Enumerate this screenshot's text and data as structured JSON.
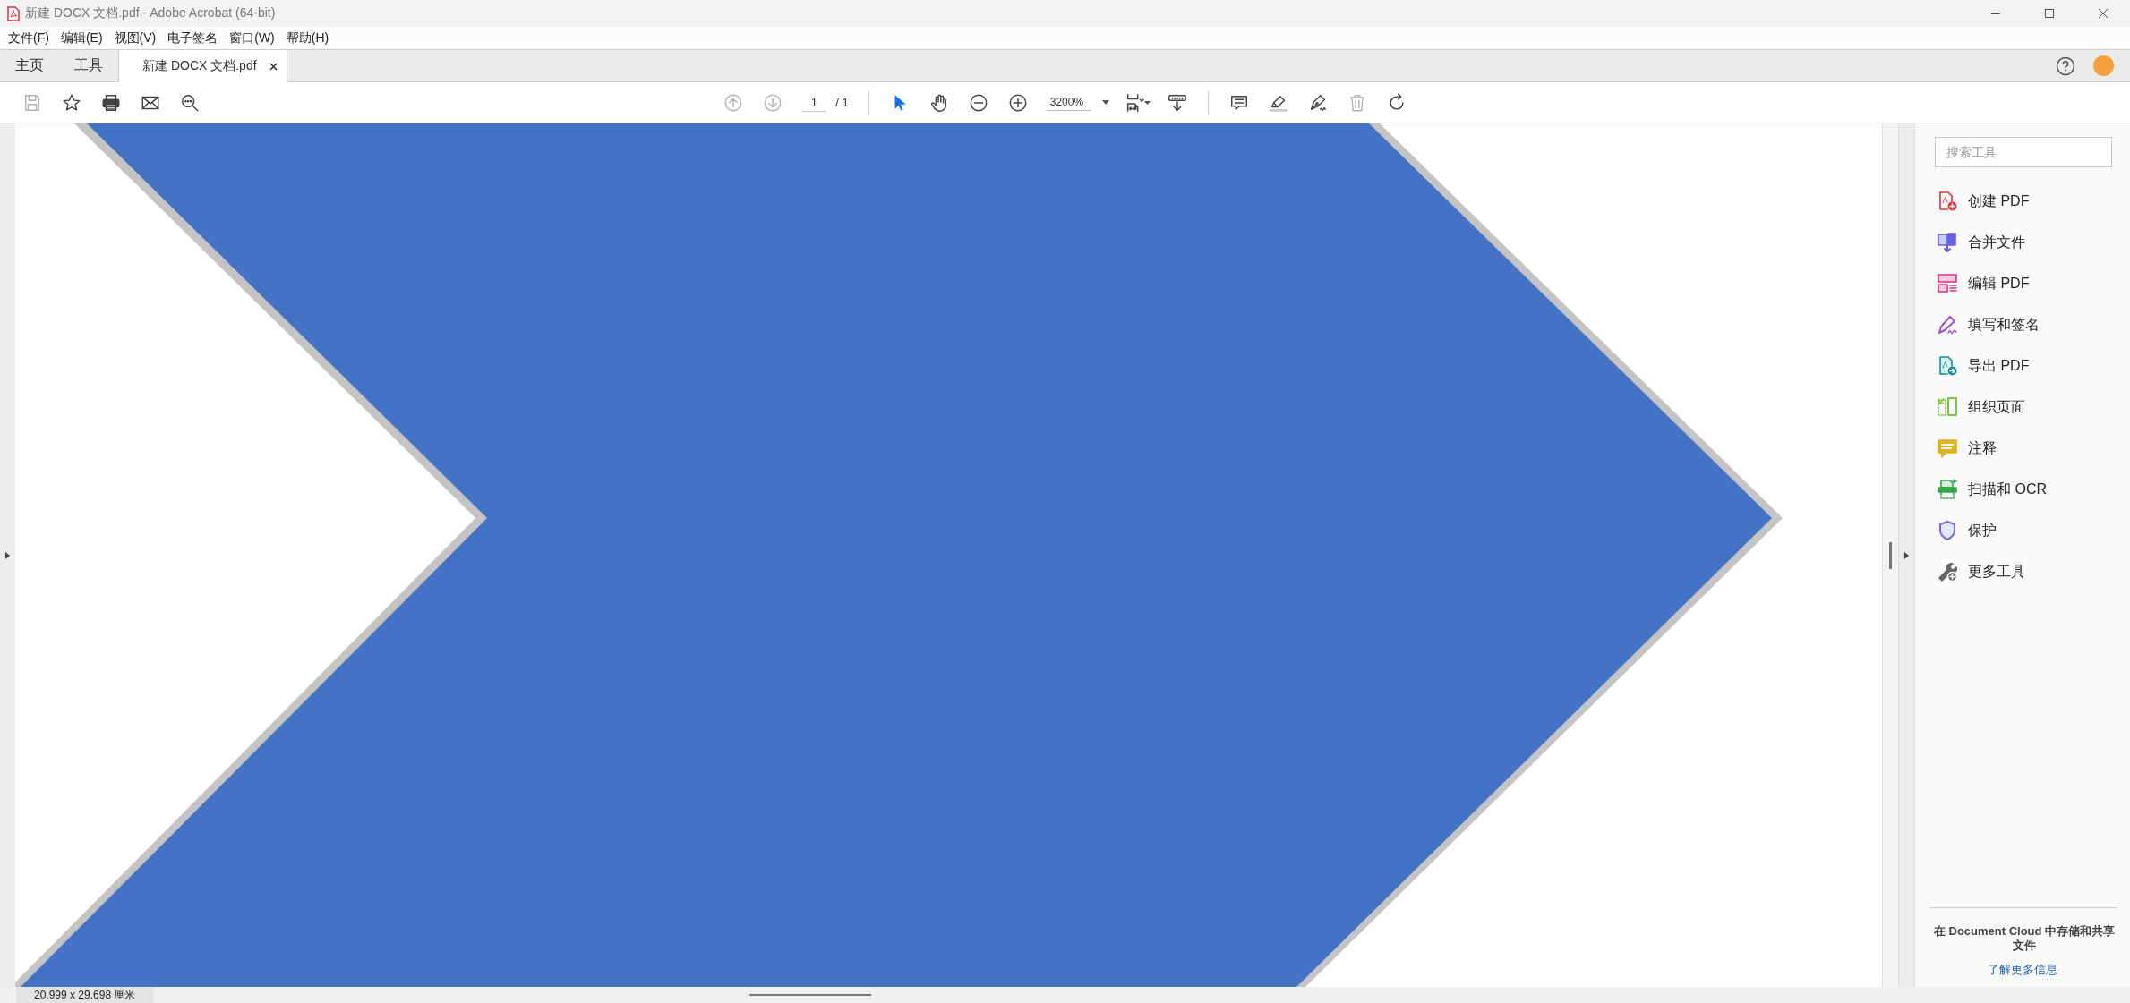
{
  "window": {
    "title": "新建 DOCX 文档.pdf - Adobe Acrobat (64-bit)"
  },
  "menu": [
    "文件(F)",
    "编辑(E)",
    "视图(V)",
    "电子签名",
    "窗口(W)",
    "帮助(H)"
  ],
  "tabs": [
    {
      "label": "主页",
      "selected": false,
      "kind": "plain"
    },
    {
      "label": "工具",
      "selected": false,
      "kind": "plain"
    },
    {
      "label": "新建 DOCX 文档.pdf",
      "selected": true,
      "kind": "document"
    }
  ],
  "toolbar": {
    "file_buttons": [
      {
        "kind": "save",
        "disabled": true
      },
      {
        "kind": "bookmark",
        "disabled": false
      },
      {
        "kind": "print",
        "disabled": false
      },
      {
        "kind": "email",
        "disabled": false
      },
      {
        "kind": "search",
        "disabled": false
      }
    ],
    "page_buttons": [
      {
        "kind": "previous",
        "disabled": true
      },
      {
        "kind": "next",
        "disabled": true
      }
    ],
    "page": {
      "value": "1",
      "total": "/ 1"
    },
    "modes": [
      {
        "kind": "select",
        "selected": true
      },
      {
        "kind": "hand",
        "selected": false
      }
    ],
    "zoom_buttons": [
      {
        "kind": "zoom-out"
      },
      {
        "kind": "zoom-in"
      }
    ],
    "zoom": {
      "value": "3200%"
    },
    "view_buttons": [
      {
        "kind": "fit"
      },
      {
        "kind": "read"
      }
    ],
    "edit_buttons": [
      {
        "kind": "comment",
        "disabled": false
      },
      {
        "kind": "highlight",
        "disabled": false
      },
      {
        "kind": "sign",
        "disabled": false
      },
      {
        "kind": "delete",
        "disabled": true
      },
      {
        "kind": "rotate",
        "disabled": false
      }
    ]
  },
  "tools_panel": {
    "search": {
      "placeholder": "搜索工具"
    },
    "tools": [
      {
        "label": "创建 PDF",
        "kind": "create"
      },
      {
        "label": "合并文件",
        "kind": "combine"
      },
      {
        "label": "编辑 PDF",
        "kind": "edit"
      },
      {
        "label": "填写和签名",
        "kind": "fill-sign"
      },
      {
        "label": "导出 PDF",
        "kind": "export"
      },
      {
        "label": "组织页面",
        "kind": "organize"
      },
      {
        "label": "注释",
        "kind": "comment"
      },
      {
        "label": "扫描和 OCR",
        "kind": "scan"
      },
      {
        "label": "保护",
        "kind": "protect"
      },
      {
        "label": "更多工具",
        "kind": "more"
      }
    ],
    "promo": "在 Document Cloud 中存储和共享文件",
    "link": "了解更多信息"
  },
  "status_bar": {
    "page_size": "20.999 x 29.698 厘米"
  }
}
